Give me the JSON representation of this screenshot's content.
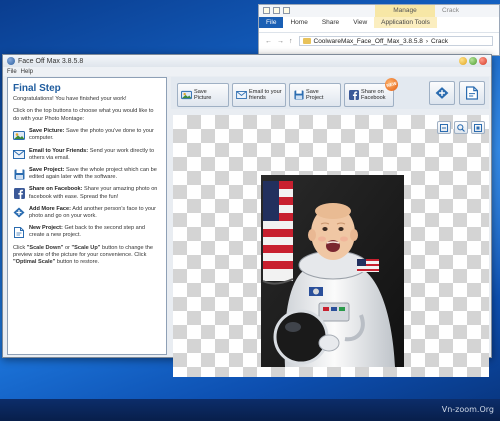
{
  "explorer": {
    "manage_label": "Manage",
    "window_title": "Crack",
    "tabs": [
      "File",
      "Home",
      "Share",
      "View",
      "Application Tools"
    ],
    "path": [
      "CoolwareMax_Face_Off_Max_3.8.5.8",
      "Crack"
    ],
    "nav_glyphs": [
      "←",
      "→",
      "↑"
    ]
  },
  "app": {
    "title": "Face Off Max   3.8.5.8",
    "menu": [
      "File",
      "Help"
    ]
  },
  "sidebar": {
    "heading": "Final Step",
    "intro": "Congratulations! You have finished your work!",
    "instructions": "Click on the top buttons to choose what you would like to do with your Photo Montage:",
    "features": [
      {
        "title": "Save Picture:",
        "text": "Save the photo you've done to your computer.",
        "icon": "save-picture-icon"
      },
      {
        "title": "Email to Your Friends:",
        "text": "Send your work directly to others via email.",
        "icon": "email-icon"
      },
      {
        "title": "Save Project:",
        "text": "Save the whole project which can be edited again later with the software.",
        "icon": "save-project-icon"
      },
      {
        "title": "Share on Facebook:",
        "text": "Share your amazing photo on facebook with ease. Spread the fun!",
        "icon": "facebook-icon"
      },
      {
        "title": "Add More Face:",
        "text": "Add another person's face to your photo and go on your work.",
        "icon": "add-face-icon"
      },
      {
        "title": "New Project:",
        "text": "Get back to the second step and create a new project.",
        "icon": "new-project-icon"
      }
    ],
    "footer_pre": "Click ",
    "scale_down": "\"Scale Down\"",
    "footer_or": " or ",
    "scale_up": "\"Scale Up\"",
    "footer_mid": " button to change the preview size of the picture for your convenience. Click ",
    "optimal": "\"Optimal Scale\"",
    "footer_end": " button to restore."
  },
  "toolbar": {
    "save_picture": "Save Picture",
    "email_line1": "Email to your",
    "email_line2": "friends",
    "save_project": "Save Project",
    "facebook_line1": "Share on",
    "facebook_line2": "Facebook",
    "new_badge": "NEW"
  },
  "watermark": "Vn-zoom.Org",
  "colors": {
    "heading": "#1f5c9e",
    "accent": "#2b6cb0",
    "facebook": "#3b5998"
  }
}
